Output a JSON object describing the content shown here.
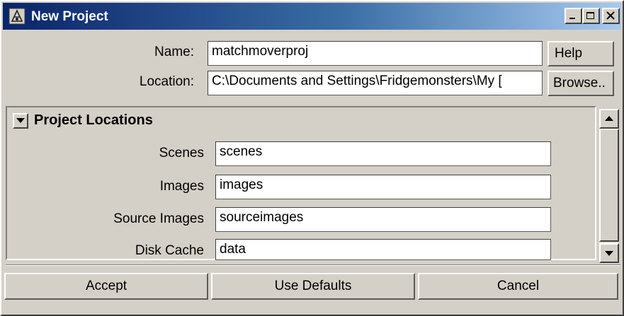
{
  "window": {
    "title": "New Project",
    "controls": [
      "minimize-icon",
      "maximize-icon",
      "close-icon"
    ],
    "title_gradient": [
      "#0a246a",
      "#a6caf0"
    ]
  },
  "form": {
    "name_label": "Name:",
    "name_value": "matchmoverproj",
    "help_label": "Help",
    "location_label": "Location:",
    "location_value": "C:\\Documents and Settings\\Fridgemonsters\\My [",
    "browse_label": "Browse.."
  },
  "project_locations": {
    "title": "Project Locations",
    "expanded": true,
    "rows": [
      {
        "label": "Scenes",
        "value": "scenes"
      },
      {
        "label": "Images",
        "value": "images"
      },
      {
        "label": "Source Images",
        "value": "sourceimages"
      },
      {
        "label": "Disk Cache",
        "value": "data"
      }
    ]
  },
  "actions": {
    "accept": "Accept",
    "use_defaults": "Use Defaults",
    "cancel": "Cancel"
  }
}
